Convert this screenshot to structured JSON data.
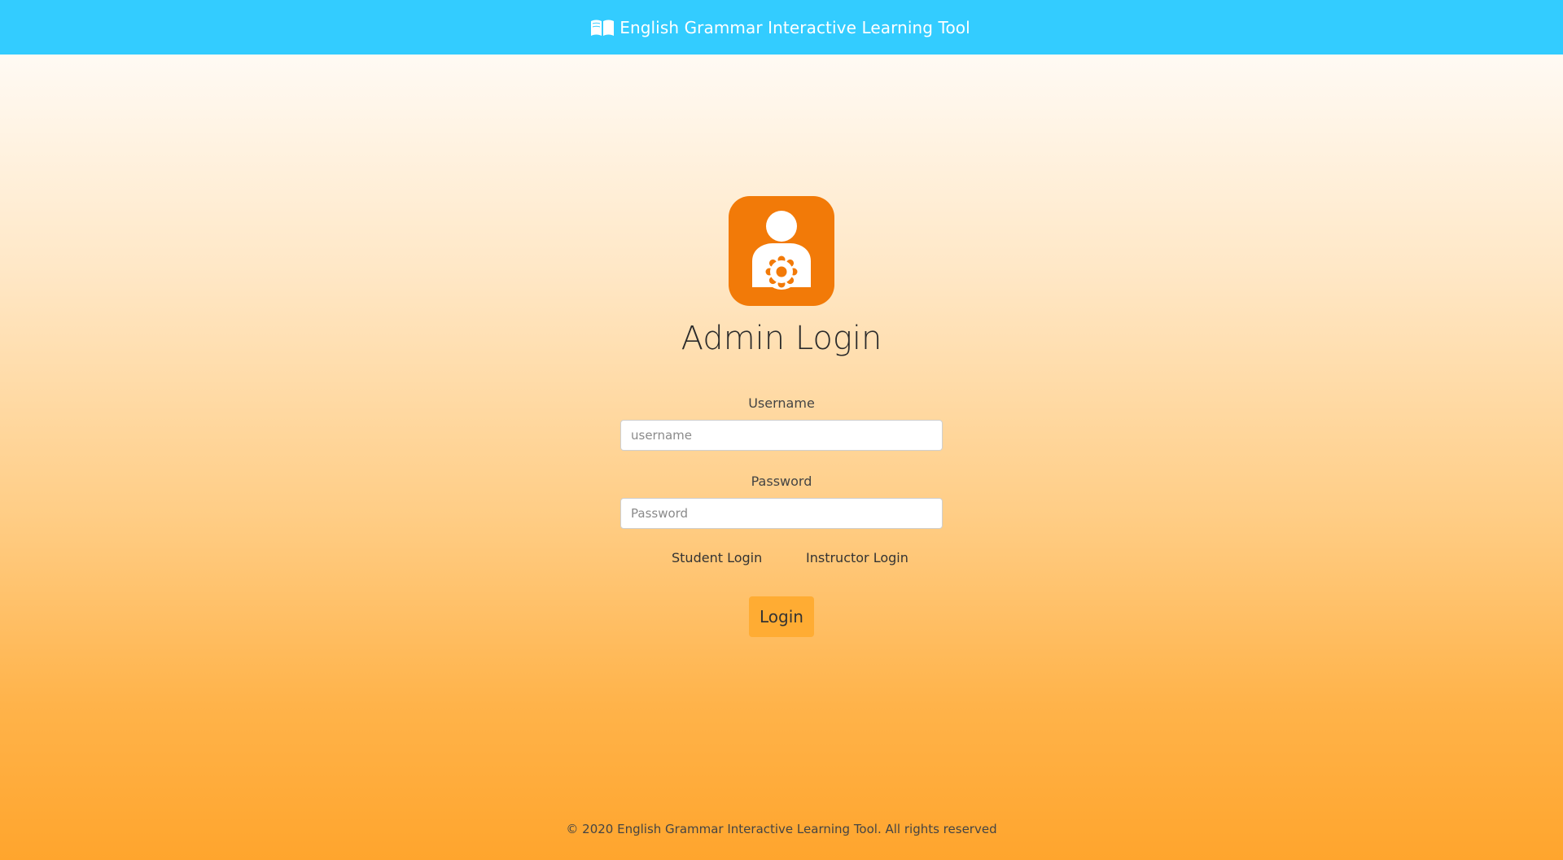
{
  "header": {
    "title": "English Grammar Interactive Learning Tool",
    "icon": "open-book-icon",
    "background_color": "#33ccff"
  },
  "login": {
    "icon": "admin-user-gear-icon",
    "icon_color": "#f27a08",
    "title": "Admin Login",
    "username_label": "Username",
    "username_placeholder": "username",
    "username_value": "",
    "password_label": "Password",
    "password_placeholder": "Password",
    "password_value": "",
    "student_link": "Student Login",
    "instructor_link": "Instructor Login",
    "submit_label": "Login",
    "submit_color": "#ffac33"
  },
  "footer": {
    "copyright": "© 2020 English Grammar Interactive Learning Tool. All rights reserved"
  }
}
